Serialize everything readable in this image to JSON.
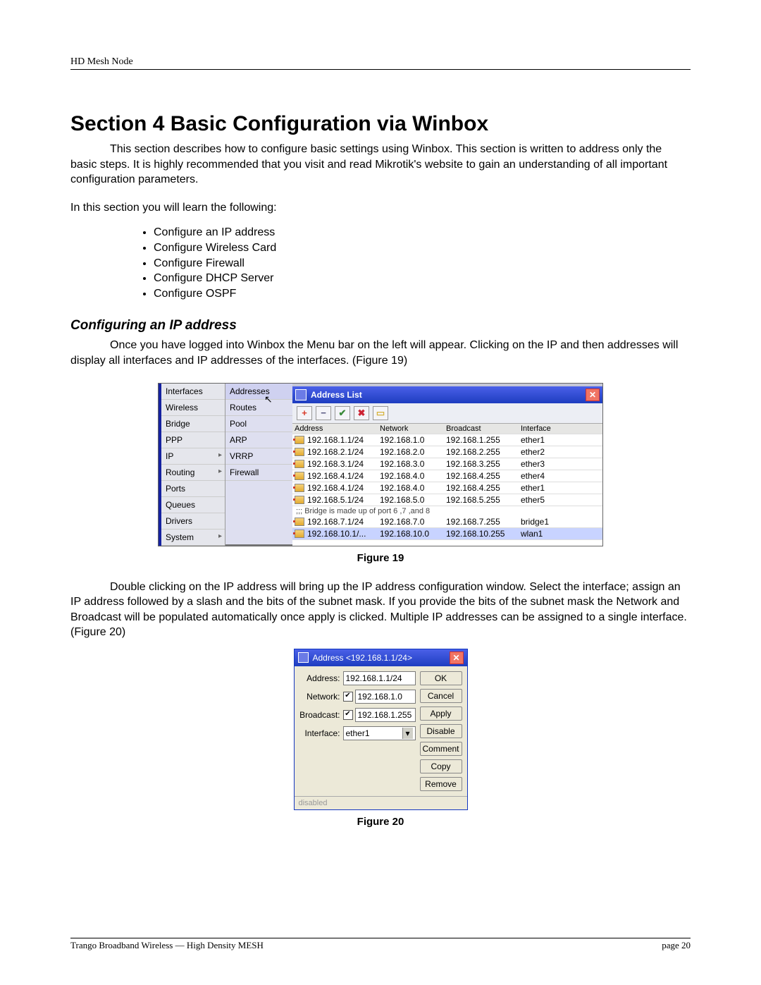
{
  "header": {
    "title": "HD Mesh Node"
  },
  "section": {
    "title": "Section 4 Basic Configuration via Winbox",
    "intro": "This section describes how to configure basic settings using Winbox.  This section is written to address only the basic steps.  It is highly recommended that you visit and read Mikrotik's website to gain an understanding of all important configuration parameters.",
    "learn_lead": "In this section you will learn the following:",
    "bullets": [
      "Configure an IP address",
      "Configure Wireless Card",
      "Configure Firewall",
      "Configure DHCP Server",
      "Configure OSPF"
    ],
    "sub1_title": "Configuring an IP address",
    "sub1_text": "Once you have logged into Winbox the Menu bar on the left will appear. Clicking on the IP and then addresses will display all interfaces and IP addresses of the interfaces.  (Figure 19)",
    "sub1_after": "Double clicking on the IP address will bring up the IP address configuration window. Select the interface; assign an IP address followed by a slash and the bits of the subnet mask. If you provide the bits of the subnet mask the Network and Broadcast will be populated automatically once apply is clicked. Multiple IP addresses can be assigned to a single interface. (Figure 20)"
  },
  "fig19": {
    "caption": "Figure 19",
    "menu1": [
      "Interfaces",
      "Wireless",
      "Bridge",
      "PPP",
      "IP",
      "Routing",
      "Ports",
      "Queues",
      "Drivers",
      "System"
    ],
    "menu1_arrows": [
      "IP",
      "Routing",
      "System"
    ],
    "menu2": [
      "Addresses",
      "Routes",
      "Pool",
      "ARP",
      "VRRP",
      "Firewall"
    ],
    "menu2_selected": "Addresses",
    "window_title": "Address List",
    "toolbar": [
      {
        "name": "add-icon",
        "glyph": "+",
        "color": "#d83b2a"
      },
      {
        "name": "remove-icon",
        "glyph": "−",
        "color": "#4f4f7a"
      },
      {
        "name": "enable-icon",
        "glyph": "✔",
        "color": "#3a8a3a"
      },
      {
        "name": "disable-icon",
        "glyph": "✖",
        "color": "#c23"
      },
      {
        "name": "comment-icon",
        "glyph": "▭",
        "color": "#d6b23a"
      }
    ],
    "columns": [
      "Address",
      "Network",
      "Broadcast",
      "Interface"
    ],
    "rows": [
      {
        "addr": "192.168.1.1/24",
        "net": "192.168.1.0",
        "bc": "192.168.1.255",
        "if": "ether1"
      },
      {
        "addr": "192.168.2.1/24",
        "net": "192.168.2.0",
        "bc": "192.168.2.255",
        "if": "ether2"
      },
      {
        "addr": "192.168.3.1/24",
        "net": "192.168.3.0",
        "bc": "192.168.3.255",
        "if": "ether3"
      },
      {
        "addr": "192.168.4.1/24",
        "net": "192.168.4.0",
        "bc": "192.168.4.255",
        "if": "ether4"
      },
      {
        "addr": "192.168.4.1/24",
        "net": "192.168.4.0",
        "bc": "192.168.4.255",
        "if": "ether1"
      },
      {
        "addr": "192.168.5.1/24",
        "net": "192.168.5.0",
        "bc": "192.168.5.255",
        "if": "ether5"
      }
    ],
    "comment_row": ";;; Bridge is made up of port 6 ,7 ,and 8",
    "rows2": [
      {
        "addr": "192.168.7.1/24",
        "net": "192.168.7.0",
        "bc": "192.168.7.255",
        "if": "bridge1"
      },
      {
        "addr": "192.168.10.1/...",
        "net": "192.168.10.0",
        "bc": "192.168.10.255",
        "if": "wlan1",
        "sel": true
      }
    ]
  },
  "fig20": {
    "caption": "Figure 20",
    "window_title": "Address <192.168.1.1/24>",
    "fields": {
      "address": {
        "label": "Address:",
        "value": "192.168.1.1/24"
      },
      "network": {
        "label": "Network:",
        "value": "192.168.1.0",
        "checked": true
      },
      "broadcast": {
        "label": "Broadcast:",
        "value": "192.168.1.255",
        "checked": true
      },
      "interface": {
        "label": "Interface:",
        "value": "ether1"
      }
    },
    "buttons": [
      "OK",
      "Cancel",
      "Apply",
      "Disable",
      "Comment",
      "Copy",
      "Remove"
    ],
    "status": "disabled"
  },
  "footer": {
    "left": "Trango Broadband Wireless — High Density MESH",
    "right": "page 20"
  }
}
